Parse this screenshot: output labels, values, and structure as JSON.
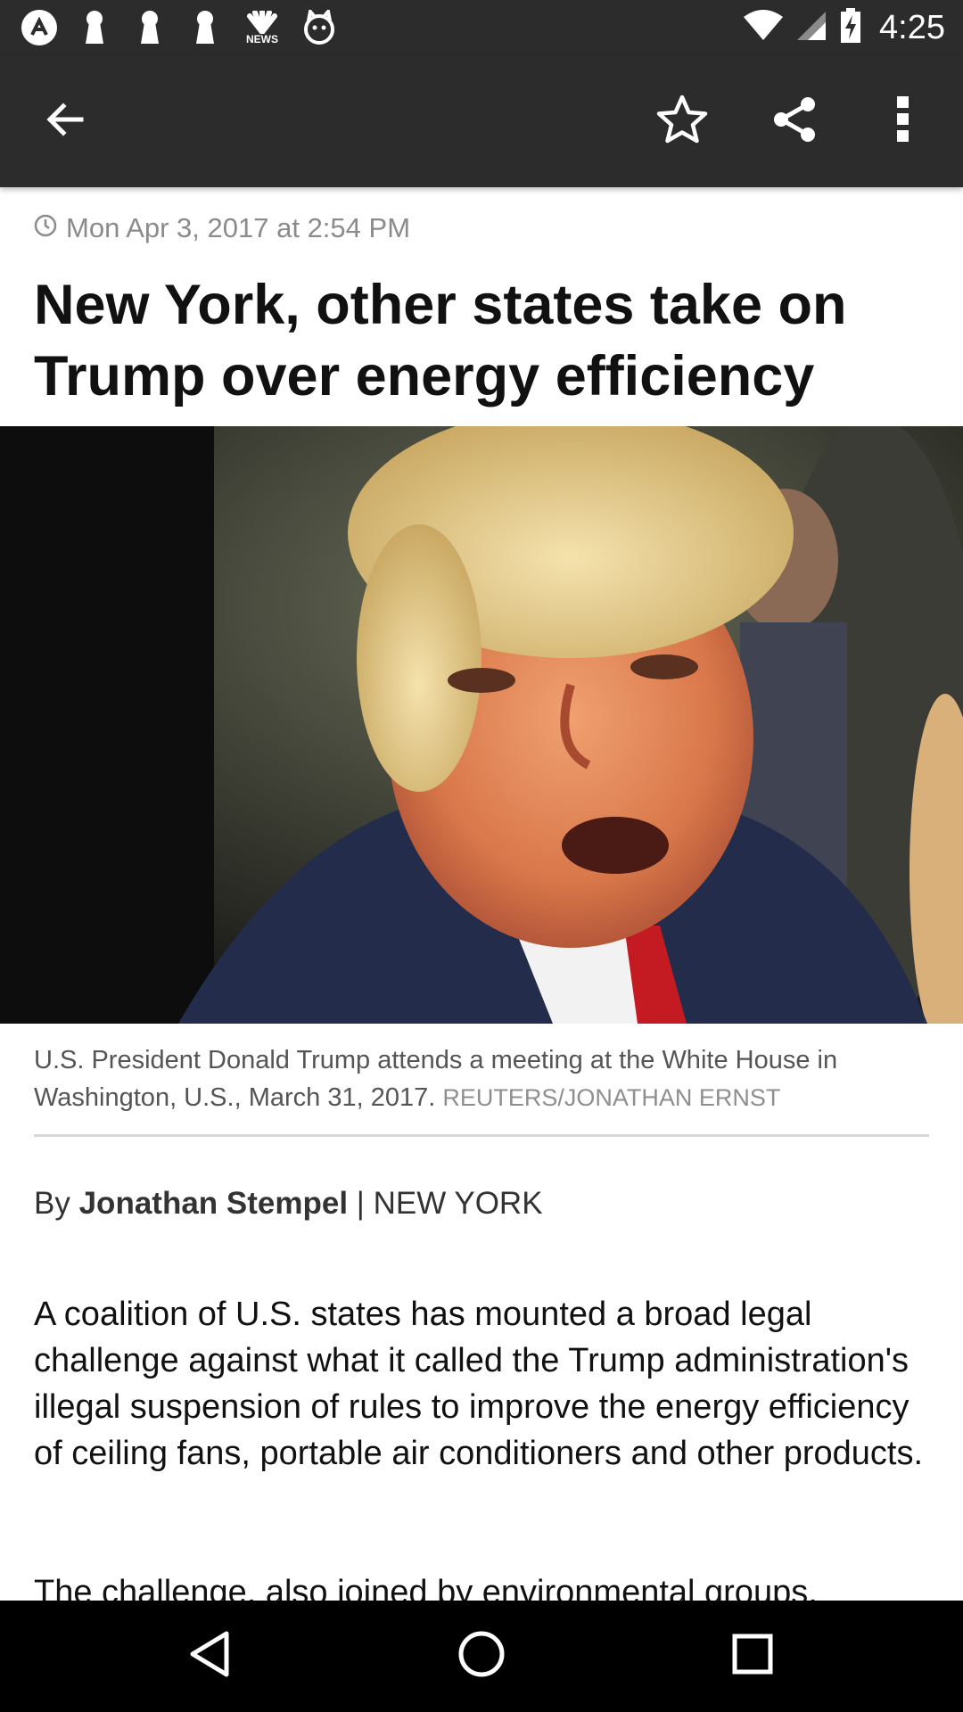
{
  "status_bar": {
    "time": "4:25",
    "left_icons": [
      "app-icon",
      "keyhole-icon",
      "keyhole-icon",
      "keyhole-icon",
      "nbc-news-icon",
      "cat-icon"
    ],
    "nbc_label": "NEWS",
    "right_icons": [
      "wifi-icon",
      "signal-icon",
      "battery-charging-icon"
    ]
  },
  "app_bar": {
    "icons": [
      "back-arrow-icon",
      "star-outline-icon",
      "share-icon",
      "more-vert-icon"
    ]
  },
  "article": {
    "timestamp": "Mon Apr 3, 2017 at 2:54 PM",
    "headline": "New York, other states take on Trump over energy efficiency",
    "image_caption": "U.S. President Donald Trump attends a meeting at the White House in Washington, U.S., March 31, 2017.",
    "image_credit": "REUTERS/JONATHAN ERNST",
    "byline_prefix": "By",
    "author": "Jonathan Stempel",
    "byline_separator": "|",
    "location": "NEW YORK",
    "paragraphs": [
      "A coalition of U.S. states has mounted a broad legal challenge against what it called the Trump administration's illegal suspension of rules to improve the energy efficiency of ceiling fans, portable air conditioners and other products.",
      "The challenge, also joined by environmental groups,"
    ]
  },
  "nav_bar": {
    "icons": [
      "nav-back-icon",
      "nav-home-icon",
      "nav-recents-icon"
    ]
  },
  "colors": {
    "bar_background": "#2c2c2c",
    "nav_background": "#000000",
    "timestamp_grey": "#8b8b8b",
    "headline": "#111111"
  }
}
